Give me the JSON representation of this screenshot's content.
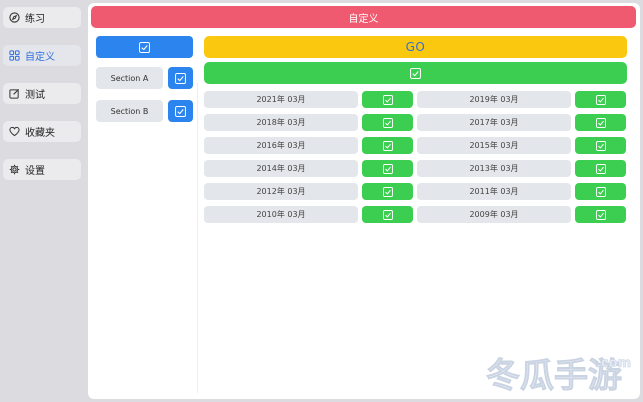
{
  "sidebar": {
    "items": [
      {
        "label": "练习",
        "icon": "compass-icon",
        "active": false
      },
      {
        "label": "自定义",
        "icon": "grid-icon",
        "active": true
      },
      {
        "label": "测试",
        "icon": "edit-icon",
        "active": false
      },
      {
        "label": "收藏夹",
        "icon": "heart-icon",
        "active": false
      },
      {
        "label": "设置",
        "icon": "gear-icon",
        "active": false
      }
    ]
  },
  "header": {
    "title": "自定义"
  },
  "sections": [
    {
      "label": "Section A",
      "checked": true
    },
    {
      "label": "Section B",
      "checked": true
    }
  ],
  "go_label": "GO",
  "dates": [
    {
      "label": "2021年 03月",
      "checked": true
    },
    {
      "label": "2019年 03月",
      "checked": true
    },
    {
      "label": "2018年 03月",
      "checked": true
    },
    {
      "label": "2017年 03月",
      "checked": true
    },
    {
      "label": "2016年 03月",
      "checked": true
    },
    {
      "label": "2015年 03月",
      "checked": true
    },
    {
      "label": "2014年 03月",
      "checked": true
    },
    {
      "label": "2013年 03月",
      "checked": true
    },
    {
      "label": "2012年 03月",
      "checked": true
    },
    {
      "label": "2011年 03月",
      "checked": true
    },
    {
      "label": "2010年 03月",
      "checked": true
    },
    {
      "label": "2009年 03月",
      "checked": true
    }
  ],
  "watermark": {
    "text": "冬瓜手游",
    "suffix": ".com"
  },
  "colors": {
    "title": "#f05a70",
    "blue": "#2c84ee",
    "green": "#3cce51",
    "yellow": "#fbc810",
    "accent_text": "#2f6fde"
  }
}
